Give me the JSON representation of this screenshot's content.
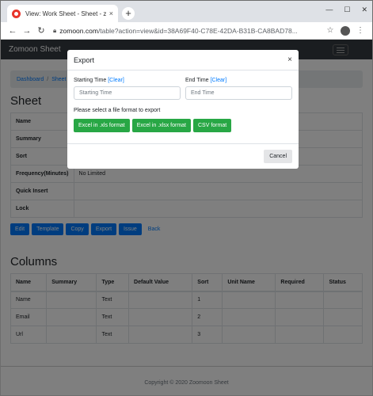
{
  "browser": {
    "tab_title": "View: Work Sheet - Sheet - zo",
    "tab_close": "×",
    "new_tab": "+",
    "win_minimize": "—",
    "win_maximize": "☐",
    "win_close": "✕",
    "url_domain": "zomoon.com",
    "url_path": "/table?action=view&id=38A69F40-C78E-42DA-B31B-CA8BAD78..."
  },
  "app": {
    "brand": "Zomoon Sheet"
  },
  "breadcrumb": {
    "item1": "Dashboard",
    "sep": "/",
    "item2": "Sheet"
  },
  "sheet": {
    "title": "Sheet",
    "rows": [
      {
        "key": "Name",
        "value": ""
      },
      {
        "key": "Summary",
        "value": ""
      },
      {
        "key": "Sort",
        "value": ""
      },
      {
        "key": "Frequency(Minutes)",
        "value": "No Limited"
      },
      {
        "key": "Quick Insert",
        "value": ""
      },
      {
        "key": "Lock",
        "value": ""
      }
    ],
    "buttons": {
      "edit": "Edit",
      "template": "Template",
      "copy": "Copy",
      "export": "Export",
      "issue": "Issue",
      "back": "Back"
    }
  },
  "columns": {
    "title": "Columns",
    "headers": [
      "Name",
      "Summary",
      "Type",
      "Default Value",
      "Sort",
      "Unit Name",
      "Required",
      "Status"
    ],
    "rows": [
      [
        "Name",
        "",
        "Text",
        "",
        "1",
        "",
        "",
        ""
      ],
      [
        "Email",
        "",
        "Text",
        "",
        "2",
        "",
        "",
        ""
      ],
      [
        "Url",
        "",
        "Text",
        "",
        "3",
        "",
        "",
        ""
      ]
    ]
  },
  "footer": {
    "text": "Copyright © 2020 Zoomoon Sheet"
  },
  "modal": {
    "title": "Export",
    "close": "×",
    "start_label": "Starting Time",
    "start_clear": "[Clear]",
    "start_placeholder": "Starting Time",
    "end_label": "End Time",
    "end_clear": "[Clear]",
    "end_placeholder": "End Time",
    "note": "Please select a file format to export",
    "fmt_xls": "Excel in .xls format",
    "fmt_xlsx": "Excel in .xlsx format",
    "fmt_csv": "CSV format",
    "cancel": "Cancel"
  },
  "colors": {
    "primary": "#007bff",
    "success": "#28a745",
    "navbar": "#343a40",
    "backdrop": "rgba(0,0,0,0.5)"
  }
}
